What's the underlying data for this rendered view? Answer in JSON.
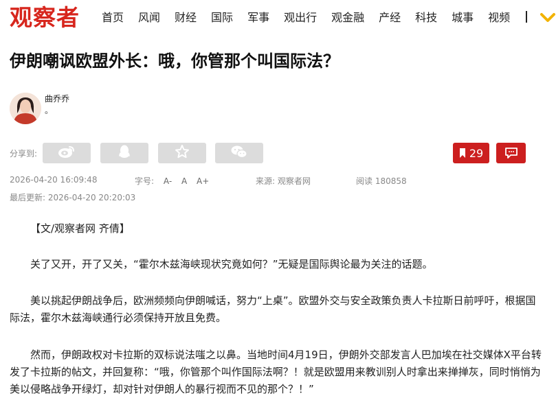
{
  "site": {
    "logo": "观察者"
  },
  "nav": {
    "items": [
      "首页",
      "风闻",
      "财经",
      "国际",
      "军事",
      "观出行",
      "观金融",
      "产经",
      "科技",
      "城事",
      "视频"
    ]
  },
  "article": {
    "title": "伊朗嘲讽欧盟外长：哦，你管那个叫国际法？",
    "author": {
      "name": "曲乔乔",
      "bio": "。"
    },
    "share": {
      "label": "分享到:",
      "icons": [
        "weibo-icon",
        "qq-icon",
        "favorite-star-icon",
        "wechat-icon"
      ]
    },
    "likes": {
      "count": "29"
    },
    "comment_icon": "comment-icon",
    "meta": {
      "date": "2026-04-20 16:09:48",
      "font_label": "字号:",
      "font_options": [
        "A-",
        "A",
        "A+"
      ],
      "source": "来源:   观察者网",
      "reads": "阅读 180858",
      "updated": "最后更新: 2026-04-20 20:20:03"
    },
    "paragraphs": [
      "【文/观察者网 齐倩】",
      "关了又开，开了又关，“霍尔木兹海峡现状究竟如何？”无疑是国际舆论最为关注的话题。",
      "美以挑起伊朗战争后，欧洲频频向伊朗喊话，努力“上桌”。欧盟外交与安全政策负责人卡拉斯日前呼吁，根据国际法，霍尔木兹海峡通行必须保持开放且免费。",
      "然而，伊朗政权对卡拉斯的双标说法嗤之以鼻。当地时间4月19日，伊朗外交部发言人巴加埃在社交媒体X平台转发了卡拉斯的帖文，并回复称：“哦，你管那个叫作国际法啊？！就是欧盟用来教训别人时拿出来掸掸灰，同时悄悄为美以侵略战争开绿灯，却对针对伊朗人的暴行视而不见的那个？！”"
    ]
  },
  "colors": {
    "brand_red": "#d7261d",
    "button_red": "#cc1f1f",
    "share_gray": "#dcdcdc",
    "more_yellow": "#f2b300"
  }
}
